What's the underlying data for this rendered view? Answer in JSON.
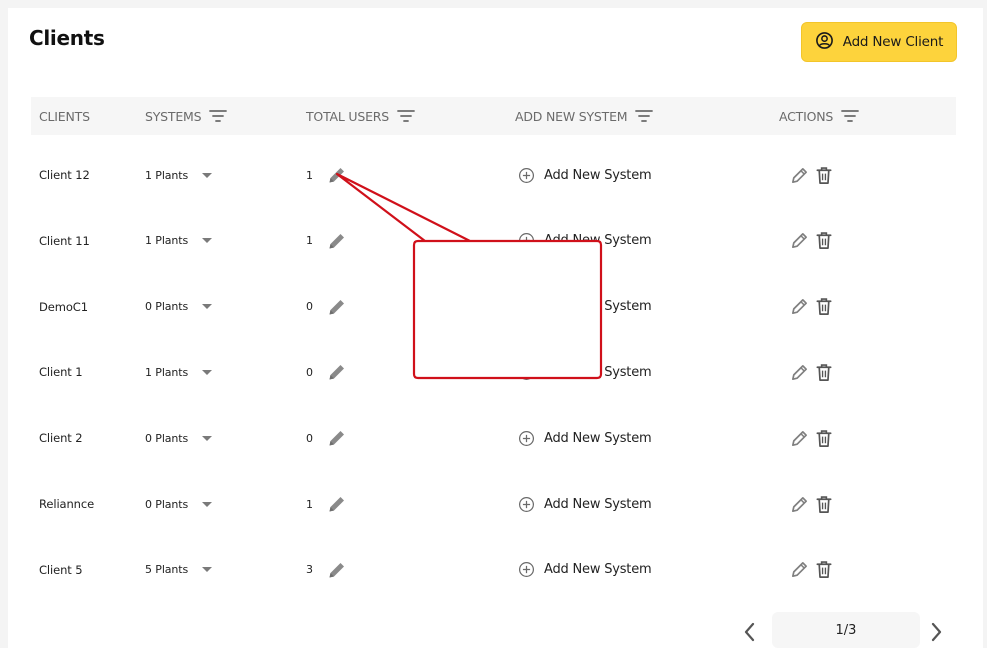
{
  "page": {
    "title": "Clients"
  },
  "toolbar": {
    "add_client_label": "Add New Client",
    "add_client_icon": "user-circle-icon"
  },
  "table": {
    "headers": [
      "CLIENTS",
      "SYSTEMS",
      "TOTAL USERS",
      "ADD NEW SYSTEM",
      "ACTIONS"
    ],
    "add_system_label": "Add New System",
    "rows": [
      {
        "client": "Client 12",
        "systems": "1 Plants",
        "users": "1"
      },
      {
        "client": "Client 11",
        "systems": "1 Plants",
        "users": "1"
      },
      {
        "client": "DemoC1",
        "systems": "0 Plants",
        "users": "0"
      },
      {
        "client": "Client 1",
        "systems": "1 Plants",
        "users": "0"
      },
      {
        "client": "Client 2",
        "systems": "0 Plants",
        "users": "0"
      },
      {
        "client": "Reliannce",
        "systems": "0 Plants",
        "users": "1"
      },
      {
        "client": "Client 5",
        "systems": "5 Plants",
        "users": "3"
      }
    ]
  },
  "pagination": {
    "label": "1/3"
  },
  "colors": {
    "accent": "#fdd33c",
    "callout_border": "#d0101a",
    "icon_gray": "#8a8a8a"
  }
}
